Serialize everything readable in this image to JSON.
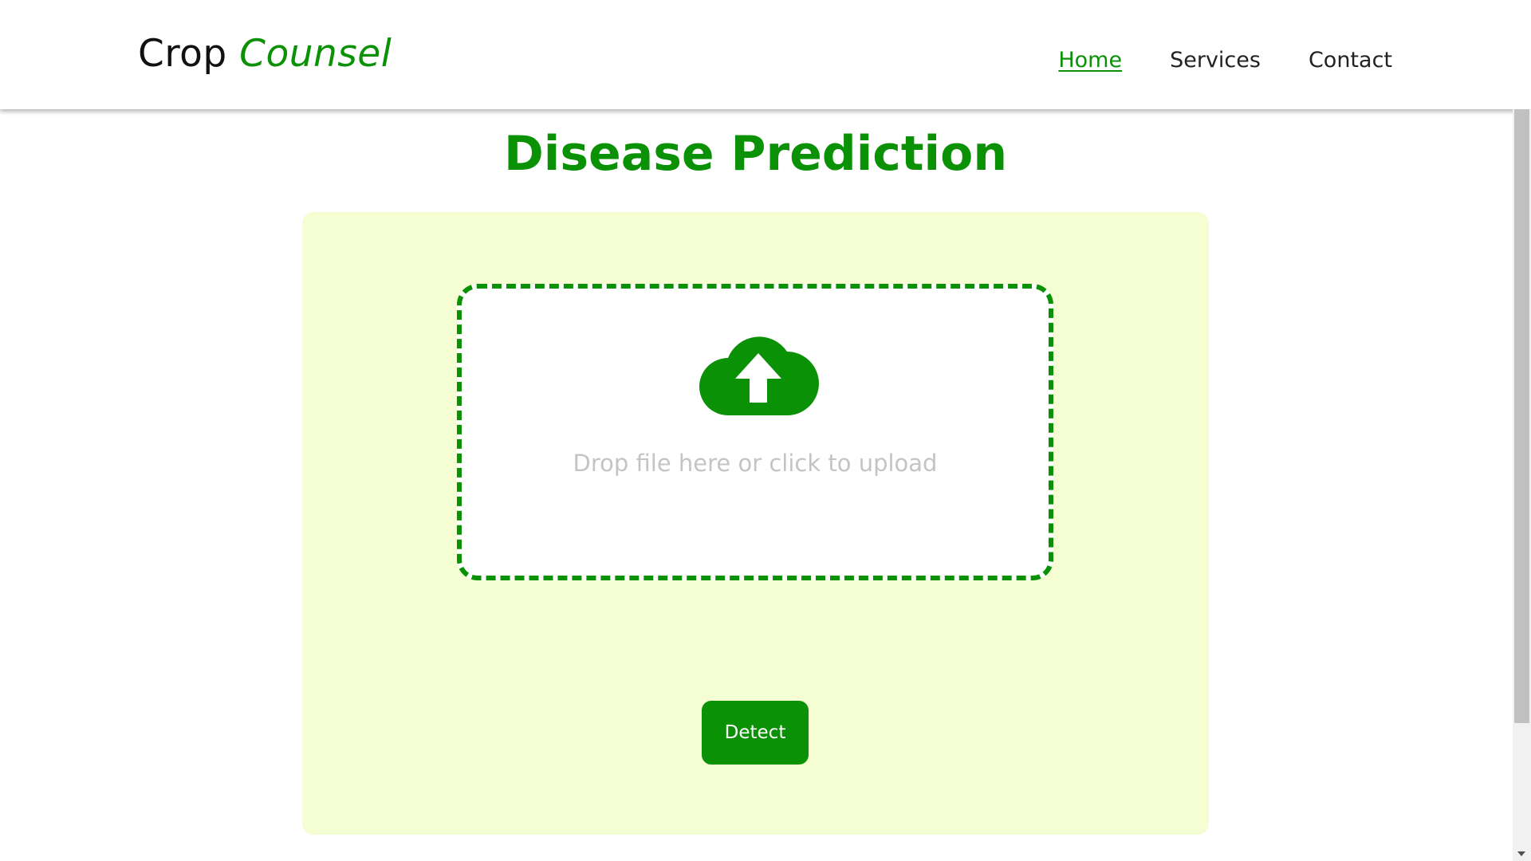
{
  "navbar": {
    "brand_first": "Crop",
    "brand_second": "Counsel",
    "links": [
      {
        "label": "Home",
        "active": true
      },
      {
        "label": "Services",
        "active": false
      },
      {
        "label": "Contact",
        "active": false
      }
    ]
  },
  "main": {
    "title": "Disease Prediction",
    "dropzone": {
      "icon": "cloud-upload-icon",
      "text": "Drop file here or click to upload"
    },
    "detect_button": "Detect"
  },
  "colors": {
    "accent": "#0b9106",
    "panel_background": "#f4fed2",
    "placeholder_text": "#c4c4c4"
  }
}
